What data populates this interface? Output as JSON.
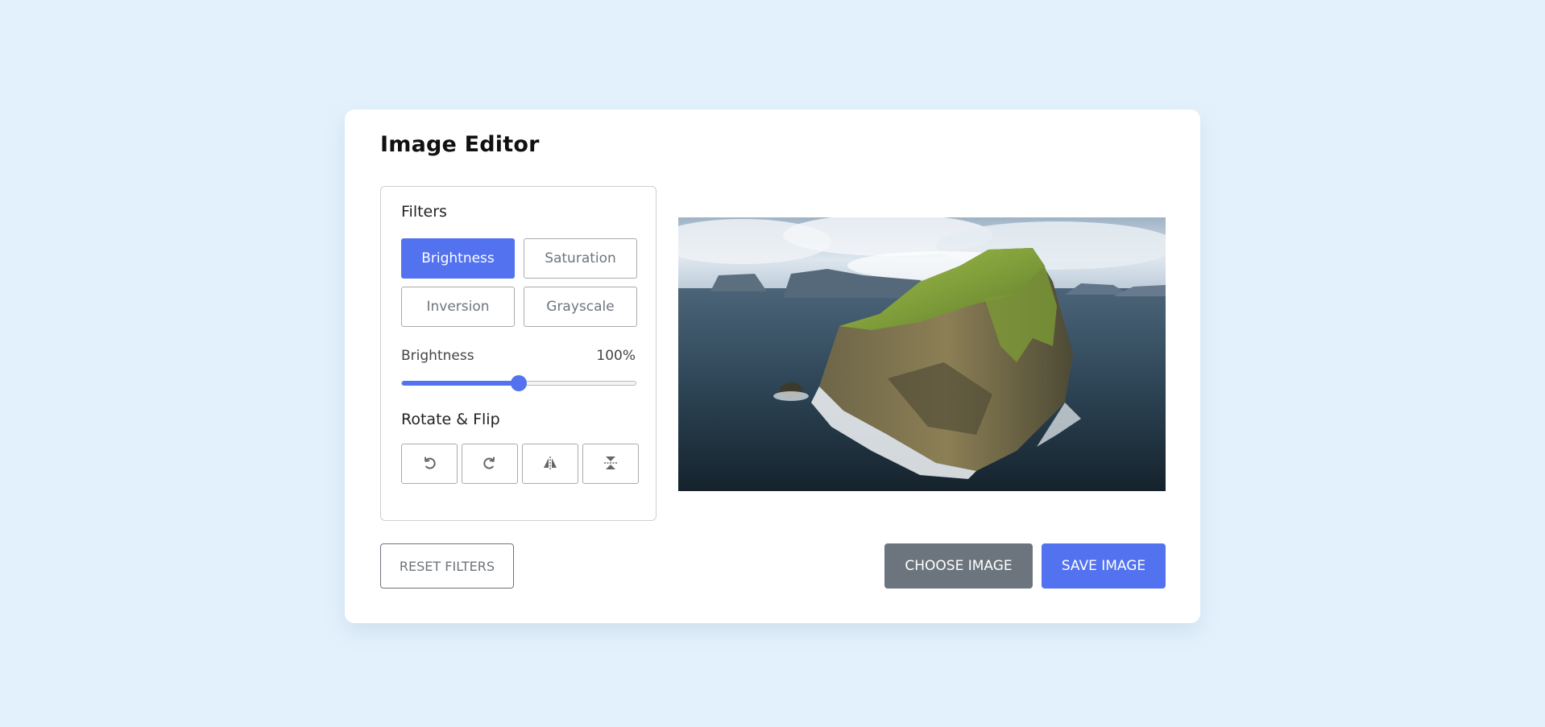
{
  "editor": {
    "title": "Image Editor"
  },
  "filters": {
    "heading": "Filters",
    "buttons": [
      {
        "label": "Brightness",
        "active": true
      },
      {
        "label": "Saturation",
        "active": false
      },
      {
        "label": "Inversion",
        "active": false
      },
      {
        "label": "Grayscale",
        "active": false
      }
    ]
  },
  "slider": {
    "label": "Brightness",
    "value_text": "100%",
    "value": 100,
    "max": 200
  },
  "rotate": {
    "heading": "Rotate & Flip",
    "buttons": [
      {
        "icon": "rotate-left-icon"
      },
      {
        "icon": "rotate-right-icon"
      },
      {
        "icon": "flip-horizontal-icon"
      },
      {
        "icon": "flip-vertical-icon"
      }
    ]
  },
  "actions": {
    "reset_label": "Reset Filters",
    "choose_label": "Choose Image",
    "save_label": "Save Image"
  },
  "colors": {
    "accent": "#5372f0",
    "secondary": "#6c757d",
    "background": "#e3f1fc"
  }
}
